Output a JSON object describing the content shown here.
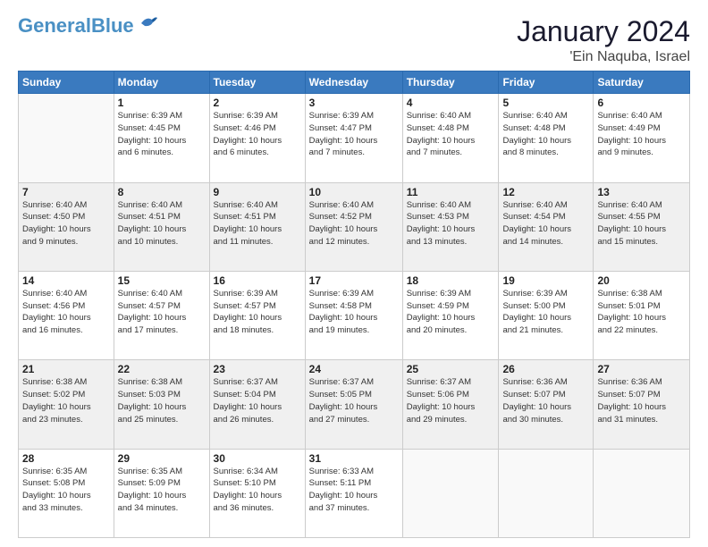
{
  "logo": {
    "general": "General",
    "blue": "Blue"
  },
  "title": "January 2024",
  "location": "'Ein Naquba, Israel",
  "headers": [
    "Sunday",
    "Monday",
    "Tuesday",
    "Wednesday",
    "Thursday",
    "Friday",
    "Saturday"
  ],
  "weeks": [
    [
      {
        "day": "",
        "info": ""
      },
      {
        "day": "1",
        "info": "Sunrise: 6:39 AM\nSunset: 4:45 PM\nDaylight: 10 hours\nand 6 minutes."
      },
      {
        "day": "2",
        "info": "Sunrise: 6:39 AM\nSunset: 4:46 PM\nDaylight: 10 hours\nand 6 minutes."
      },
      {
        "day": "3",
        "info": "Sunrise: 6:39 AM\nSunset: 4:47 PM\nDaylight: 10 hours\nand 7 minutes."
      },
      {
        "day": "4",
        "info": "Sunrise: 6:40 AM\nSunset: 4:48 PM\nDaylight: 10 hours\nand 7 minutes."
      },
      {
        "day": "5",
        "info": "Sunrise: 6:40 AM\nSunset: 4:48 PM\nDaylight: 10 hours\nand 8 minutes."
      },
      {
        "day": "6",
        "info": "Sunrise: 6:40 AM\nSunset: 4:49 PM\nDaylight: 10 hours\nand 9 minutes."
      }
    ],
    [
      {
        "day": "7",
        "info": "Sunrise: 6:40 AM\nSunset: 4:50 PM\nDaylight: 10 hours\nand 9 minutes."
      },
      {
        "day": "8",
        "info": "Sunrise: 6:40 AM\nSunset: 4:51 PM\nDaylight: 10 hours\nand 10 minutes."
      },
      {
        "day": "9",
        "info": "Sunrise: 6:40 AM\nSunset: 4:51 PM\nDaylight: 10 hours\nand 11 minutes."
      },
      {
        "day": "10",
        "info": "Sunrise: 6:40 AM\nSunset: 4:52 PM\nDaylight: 10 hours\nand 12 minutes."
      },
      {
        "day": "11",
        "info": "Sunrise: 6:40 AM\nSunset: 4:53 PM\nDaylight: 10 hours\nand 13 minutes."
      },
      {
        "day": "12",
        "info": "Sunrise: 6:40 AM\nSunset: 4:54 PM\nDaylight: 10 hours\nand 14 minutes."
      },
      {
        "day": "13",
        "info": "Sunrise: 6:40 AM\nSunset: 4:55 PM\nDaylight: 10 hours\nand 15 minutes."
      }
    ],
    [
      {
        "day": "14",
        "info": "Sunrise: 6:40 AM\nSunset: 4:56 PM\nDaylight: 10 hours\nand 16 minutes."
      },
      {
        "day": "15",
        "info": "Sunrise: 6:40 AM\nSunset: 4:57 PM\nDaylight: 10 hours\nand 17 minutes."
      },
      {
        "day": "16",
        "info": "Sunrise: 6:39 AM\nSunset: 4:57 PM\nDaylight: 10 hours\nand 18 minutes."
      },
      {
        "day": "17",
        "info": "Sunrise: 6:39 AM\nSunset: 4:58 PM\nDaylight: 10 hours\nand 19 minutes."
      },
      {
        "day": "18",
        "info": "Sunrise: 6:39 AM\nSunset: 4:59 PM\nDaylight: 10 hours\nand 20 minutes."
      },
      {
        "day": "19",
        "info": "Sunrise: 6:39 AM\nSunset: 5:00 PM\nDaylight: 10 hours\nand 21 minutes."
      },
      {
        "day": "20",
        "info": "Sunrise: 6:38 AM\nSunset: 5:01 PM\nDaylight: 10 hours\nand 22 minutes."
      }
    ],
    [
      {
        "day": "21",
        "info": "Sunrise: 6:38 AM\nSunset: 5:02 PM\nDaylight: 10 hours\nand 23 minutes."
      },
      {
        "day": "22",
        "info": "Sunrise: 6:38 AM\nSunset: 5:03 PM\nDaylight: 10 hours\nand 25 minutes."
      },
      {
        "day": "23",
        "info": "Sunrise: 6:37 AM\nSunset: 5:04 PM\nDaylight: 10 hours\nand 26 minutes."
      },
      {
        "day": "24",
        "info": "Sunrise: 6:37 AM\nSunset: 5:05 PM\nDaylight: 10 hours\nand 27 minutes."
      },
      {
        "day": "25",
        "info": "Sunrise: 6:37 AM\nSunset: 5:06 PM\nDaylight: 10 hours\nand 29 minutes."
      },
      {
        "day": "26",
        "info": "Sunrise: 6:36 AM\nSunset: 5:07 PM\nDaylight: 10 hours\nand 30 minutes."
      },
      {
        "day": "27",
        "info": "Sunrise: 6:36 AM\nSunset: 5:07 PM\nDaylight: 10 hours\nand 31 minutes."
      }
    ],
    [
      {
        "day": "28",
        "info": "Sunrise: 6:35 AM\nSunset: 5:08 PM\nDaylight: 10 hours\nand 33 minutes."
      },
      {
        "day": "29",
        "info": "Sunrise: 6:35 AM\nSunset: 5:09 PM\nDaylight: 10 hours\nand 34 minutes."
      },
      {
        "day": "30",
        "info": "Sunrise: 6:34 AM\nSunset: 5:10 PM\nDaylight: 10 hours\nand 36 minutes."
      },
      {
        "day": "31",
        "info": "Sunrise: 6:33 AM\nSunset: 5:11 PM\nDaylight: 10 hours\nand 37 minutes."
      },
      {
        "day": "",
        "info": ""
      },
      {
        "day": "",
        "info": ""
      },
      {
        "day": "",
        "info": ""
      }
    ]
  ]
}
